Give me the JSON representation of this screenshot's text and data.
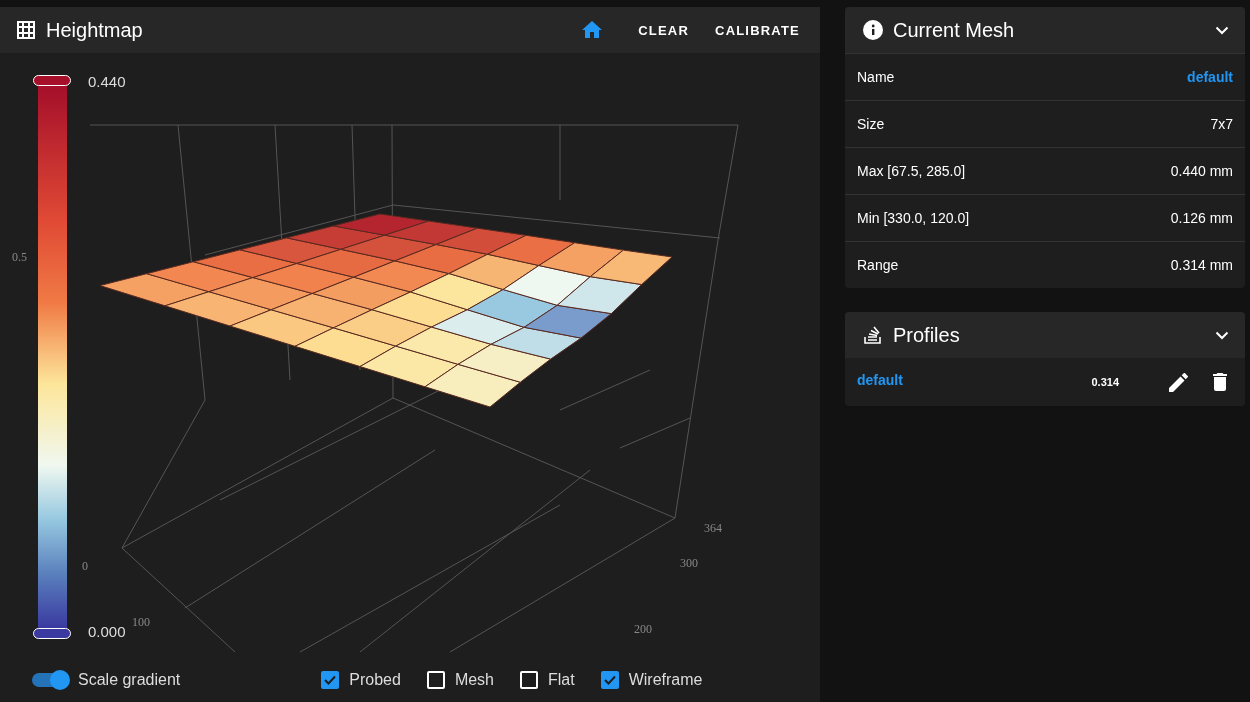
{
  "heightmap": {
    "title": "Heightmap",
    "actions": [
      {
        "kind": "home"
      },
      {
        "kind": "text",
        "label": "CLEAR"
      },
      {
        "kind": "text",
        "label": "CALIBRATE"
      }
    ],
    "colorbar": {
      "max": "0.440",
      "min": "0.000"
    },
    "axis_labels": [
      "0.5",
      "0",
      "100",
      "364",
      "300",
      "200"
    ],
    "controls": [
      {
        "kind": "toggle",
        "label": "Scale gradient",
        "on": true
      },
      {
        "kind": "checkbox",
        "label": "Probed",
        "checked": true
      },
      {
        "kind": "checkbox",
        "label": "Mesh",
        "checked": false
      },
      {
        "kind": "checkbox",
        "label": "Flat",
        "checked": false
      },
      {
        "kind": "checkbox",
        "label": "Wireframe",
        "checked": true
      }
    ]
  },
  "current_mesh": {
    "title": "Current Mesh",
    "expanded": true,
    "rows": [
      {
        "label": "Name",
        "value": "default",
        "kind": "link"
      },
      {
        "label": "Size",
        "value": "7x7",
        "kind": "text"
      },
      {
        "label": "Max [67.5, 285.0]",
        "value": "0.440 mm",
        "kind": "text"
      },
      {
        "label": "Min [330.0, 120.0]",
        "value": "0.126 mm",
        "kind": "text"
      },
      {
        "label": "Range",
        "value": "0.314 mm",
        "kind": "text"
      }
    ]
  },
  "profiles": {
    "title": "Profiles",
    "expanded": true,
    "rows": [
      {
        "name": "default",
        "range": "0.314"
      }
    ]
  }
}
